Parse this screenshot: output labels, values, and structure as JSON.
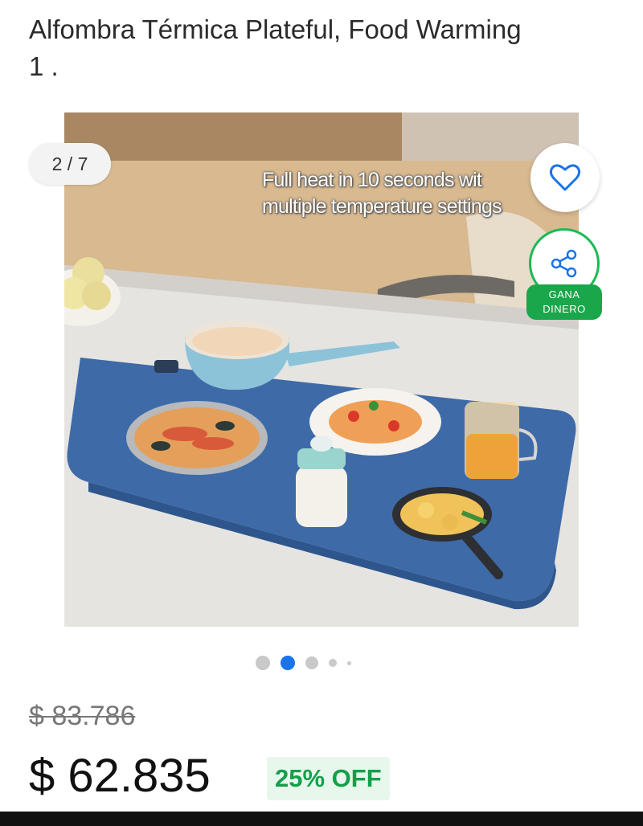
{
  "product": {
    "title_line1": "Alfombra Térmica Plateful, Food Warming",
    "title_line2": "1 .",
    "old_price": "$ 83.786",
    "price": "$ 62.835",
    "discount": "25% OFF"
  },
  "gallery": {
    "counter": "2 / 7",
    "caption_line1": "Full heat in 10 seconds wit",
    "caption_line2": "multiple temperature settings",
    "active_index": 1,
    "dot_count": 5
  },
  "actions": {
    "favorite_icon": "heart-icon",
    "share_icon": "share-icon",
    "earn_label_line1": "GANA",
    "earn_label_line2": "DINERO"
  },
  "colors": {
    "accent_green": "#1aa64a",
    "active_dot": "#1a73e8",
    "discount_text": "#12a049"
  }
}
